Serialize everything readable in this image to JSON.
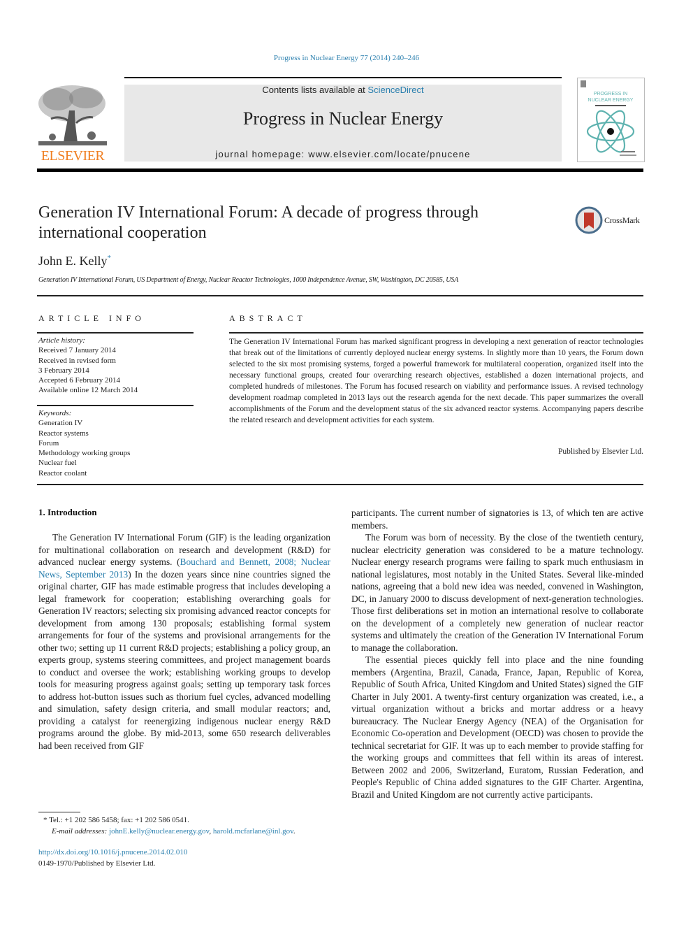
{
  "running_head": "Progress in Nuclear Energy 77 (2014) 240–246",
  "masthead": {
    "publisher_logo_text": "ELSEVIER",
    "contents_prefix": "Contents lists available at ",
    "contents_link": "ScienceDirect",
    "journal_name": "Progress in Nuclear Energy",
    "homepage_line": "journal homepage: www.elsevier.com/locate/pnucene",
    "cover": {
      "title_line1": "PROGRESS IN",
      "title_line2": "NUCLEAR ENERGY",
      "accent_color": "#5fb3b0"
    },
    "brand_color": "#f07f22",
    "link_color": "#2a7fae"
  },
  "article": {
    "title": "Generation IV International Forum: A decade of progress through international cooperation",
    "crossmark_label": "CrossMark",
    "author": "John E. Kelly",
    "author_marker": "*",
    "affiliation": "Generation IV International Forum, US Department of Energy, Nuclear Reactor Technologies, 1000 Independence Avenue, SW, Washington, DC 20585, USA"
  },
  "article_info": {
    "heading": "ARTICLE INFO",
    "history_label": "Article history:",
    "history": [
      "Received 7 January 2014",
      "Received in revised form",
      "3 February 2014",
      "Accepted 6 February 2014",
      "Available online 12 March 2014"
    ],
    "keywords_label": "Keywords:",
    "keywords": [
      "Generation IV",
      "Reactor systems",
      "Forum",
      "Methodology working groups",
      "Nuclear fuel",
      "Reactor coolant"
    ]
  },
  "abstract": {
    "heading": "ABSTRACT",
    "text": "The Generation IV International Forum has marked significant progress in developing a next generation of reactor technologies that break out of the limitations of currently deployed nuclear energy systems. In slightly more than 10 years, the Forum down selected to the six most promising systems, forged a powerful framework for multilateral cooperation, organized itself into the necessary functional groups, created four overarching research objectives, established a dozen international projects, and completed hundreds of milestones. The Forum has focused research on viability and performance issues. A revised technology development roadmap completed in 2013 lays out the research agenda for the next decade. This paper summarizes the overall accomplishments of the Forum and the development status of the six advanced reactor systems. Accompanying papers describe the related research and development activities for each system.",
    "published_by": "Published by Elsevier Ltd."
  },
  "body": {
    "section_heading": "1.  Introduction",
    "left_p1_before_cite": "The Generation IV International Forum (GIF) is the leading organization for multinational collaboration on research and development (R&D) for advanced nuclear energy systems. (",
    "left_p1_cite": "Bouchard and Bennett, 2008; Nuclear News, September 2013",
    "left_p1_after_cite": ") In the dozen years since nine countries signed the original charter, GIF has made estimable progress that includes developing a legal framework for cooperation; establishing overarching goals for Generation IV reactors; selecting six promising advanced reactor concepts for development from among 130 proposals; establishing formal system arrangements for four of the systems and provisional arrangements for the other two; setting up 11 current R&D projects; establishing a policy group, an experts group, systems steering committees, and project management boards to conduct and oversee the work; establishing working groups to develop tools for measuring progress against goals; setting up temporary task forces to address hot-button issues such as thorium fuel cycles, advanced modelling and simulation, safety design criteria, and small modular reactors; and, providing a catalyst for reenergizing indigenous nuclear energy R&D programs around the globe. By mid-2013, some 650 research deliverables had been received from GIF",
    "right_continuation": "participants. The current number of signatories is 13, of which ten are active members.",
    "right_p2": "The Forum was born of necessity. By the close of the twentieth century, nuclear electricity generation was considered to be a mature technology. Nuclear energy research programs were failing to spark much enthusiasm in national legislatures, most notably in the United States. Several like-minded nations, agreeing that a bold new idea was needed, convened in Washington, DC, in January 2000 to discuss development of next-generation technologies. Those first deliberations set in motion an international resolve to collaborate on the development of a completely new generation of nuclear reactor systems and ultimately the creation of the Generation IV International Forum to manage the collaboration.",
    "right_p3": "The essential pieces quickly fell into place and the nine founding members (Argentina, Brazil, Canada, France, Japan, Republic of Korea, Republic of South Africa, United Kingdom and United States) signed the GIF Charter in July 2001. A twenty-first century organization was created, i.e., a virtual organization without a bricks and mortar address or a heavy bureaucracy. The Nuclear Energy Agency (NEA) of the Organisation for Economic Co-operation and Development (OECD) was chosen to provide the technical secretariat for GIF. It was up to each member to provide staffing for the working groups and committees that fell within its areas of interest. Between 2002 and 2006, Switzerland, Euratom, Russian Federation, and People's Republic of China added signatures to the GIF Charter. Argentina, Brazil and United Kingdom are not currently active participants."
  },
  "footnote": {
    "marker": "*",
    "contact": "Tel.: +1 202 586 5458; fax: +1 202 586 0541.",
    "email_label": "E-mail addresses:",
    "emails": [
      "johnE.kelly@nuclear.energy.gov",
      "harold.mcfarlane@inl.gov"
    ],
    "email_separator": ", ",
    "email_end": "."
  },
  "doi": {
    "link": "http://dx.doi.org/10.1016/j.pnucene.2014.02.010",
    "issn_line": "0149-1970/Published by Elsevier Ltd."
  }
}
